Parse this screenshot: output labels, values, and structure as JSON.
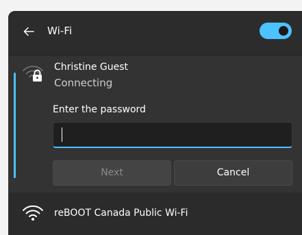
{
  "header": {
    "title": "Wi-Fi",
    "toggle_state": "on",
    "accent_color": "#4cc2ff"
  },
  "icons": {
    "back": "arrow-left-icon",
    "active_network": "wifi-lock-icon",
    "other_network": "wifi-icon"
  },
  "active_network": {
    "name": "Christine Guest",
    "status": "Connecting",
    "password_label": "Enter the password",
    "password_value": "",
    "next_label": "Next",
    "cancel_label": "Cancel"
  },
  "networks": [
    {
      "name": "reBOOT Canada Public Wi-Fi"
    }
  ]
}
